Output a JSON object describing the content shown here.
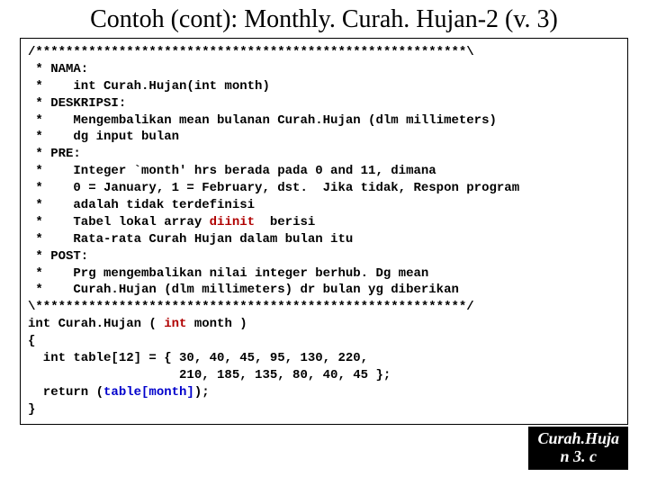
{
  "title": "Contoh (cont): Monthly. Curah. Hujan-2 (v. 3)",
  "code": {
    "l1": "/*********************************************************\\",
    "l2": " * NAMA:",
    "l3": " *    int Curah.Hujan(int month)",
    "l4": " * DESKRIPSI:",
    "l5": " *    Mengembalikan mean bulanan Curah.Hujan (dlm millimeters)",
    "l6": " *    dg input bulan",
    "l7": " * PRE:",
    "l8": " *    Integer `month' hrs berada pada 0 and 11, dimana",
    "l9": " *    0 = January, 1 = February, dst.  Jika tidak, Respon program",
    "l10": " *    adalah tidak terdefinisi",
    "l11a": " *    Tabel lokal array ",
    "l11b": "diinit",
    "l11c": "  berisi",
    "l12": " *    Rata-rata Curah Hujan dalam bulan itu",
    "l13": " * POST:",
    "l14": " *    Prg mengembalikan nilai integer berhub. Dg mean",
    "l15": " *    Curah.Hujan (dlm millimeters) dr bulan yg diberikan",
    "l16": "\\*********************************************************/",
    "l17a": "int Curah.Hujan ( ",
    "l17b": "int",
    "l17c": " month )",
    "l18": "{",
    "l19": "  int table[12] = { 30, 40, 45, 95, 130, 220,",
    "l20": "                    210, 185, 135, 80, 40, 45 };",
    "l21a": "  return (",
    "l21b": "table[month]",
    "l21c": ");",
    "l22": "}"
  },
  "badge": {
    "line1": "Curah.Huja",
    "line2": "n 3. c"
  }
}
